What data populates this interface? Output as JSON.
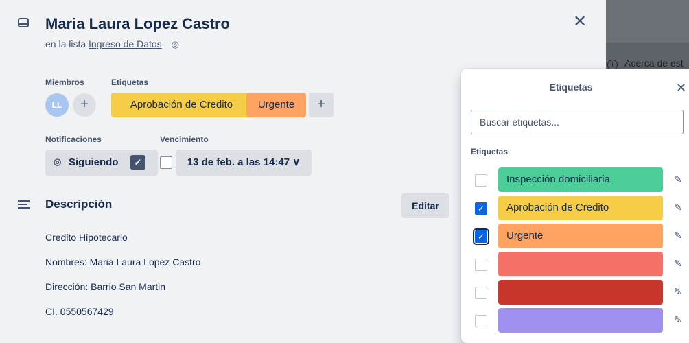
{
  "card": {
    "title": "Maria Laura Lopez Castro",
    "in_list_prefix": "en la lista",
    "list_name": "Ingreso de Datos",
    "members_label": "Miembros",
    "labels_label": "Etiquetas",
    "member_initials": "LL",
    "labels": [
      "Aprobación de Credito",
      "Urgente"
    ],
    "notifications_label": "Notificaciones",
    "following_label": "Siguiendo",
    "due_label": "Vencimiento",
    "due_value": "13 de feb. a las 14:47 ∨",
    "description_title": "Descripción",
    "edit_label": "Editar",
    "description_lines": [
      "Credito Hipotecario",
      "Nombres: Maria Laura Lopez Castro",
      "Dirección: Barrio San Martin",
      "CI. 0550567429"
    ]
  },
  "backdrop": {
    "about_text": "Acerca de est"
  },
  "popover": {
    "title": "Etiquetas",
    "search_placeholder": "Buscar etiquetas...",
    "section_label": "Etiquetas",
    "items": [
      {
        "name": "Inspección domiciliaria",
        "color": "#4bce97",
        "checked": false
      },
      {
        "name": "Aprobación de Credito",
        "color": "#f5cd47",
        "checked": true
      },
      {
        "name": "Urgente",
        "color": "#fea362",
        "checked": true
      },
      {
        "name": "",
        "color": "#f87168",
        "checked": false
      },
      {
        "name": "",
        "color": "#c9372c",
        "checked": false
      },
      {
        "name": "",
        "color": "#9f8fef",
        "checked": false
      }
    ]
  },
  "icons": {
    "close": "close-icon",
    "eye": "eye-icon",
    "plus": "plus-icon",
    "check": "check-icon",
    "pencil": "pencil-icon",
    "card": "card-icon",
    "description": "description-icon",
    "info": "info-icon"
  }
}
